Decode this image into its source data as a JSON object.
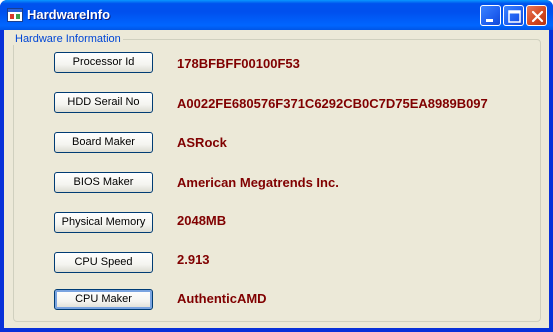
{
  "window": {
    "title": "HardwareInfo",
    "icon": "app-window-icon",
    "controls": [
      "minimize-icon",
      "maximize-icon",
      "close-icon"
    ]
  },
  "group": {
    "legend": "Hardware Information"
  },
  "rows": [
    {
      "button": "Processor Id",
      "value": "178BFBFF00100F53"
    },
    {
      "button": "HDD Serail No",
      "value": "A0022FE680576F371C6292CB0C7D75EA8989B097"
    },
    {
      "button": "Board Maker",
      "value": "ASRock"
    },
    {
      "button": "BIOS Maker",
      "value": "American Megatrends Inc."
    },
    {
      "button": "Physical Memory",
      "value": "2048MB"
    },
    {
      "button": "CPU Speed",
      "value": "2.913"
    },
    {
      "button": "CPU Maker",
      "value": "AuthenticAMD"
    }
  ],
  "colors": {
    "title_bar": "#0054e3",
    "value_text": "#800000",
    "legend_text": "#0046d5",
    "client_bg": "#ece9d8"
  }
}
